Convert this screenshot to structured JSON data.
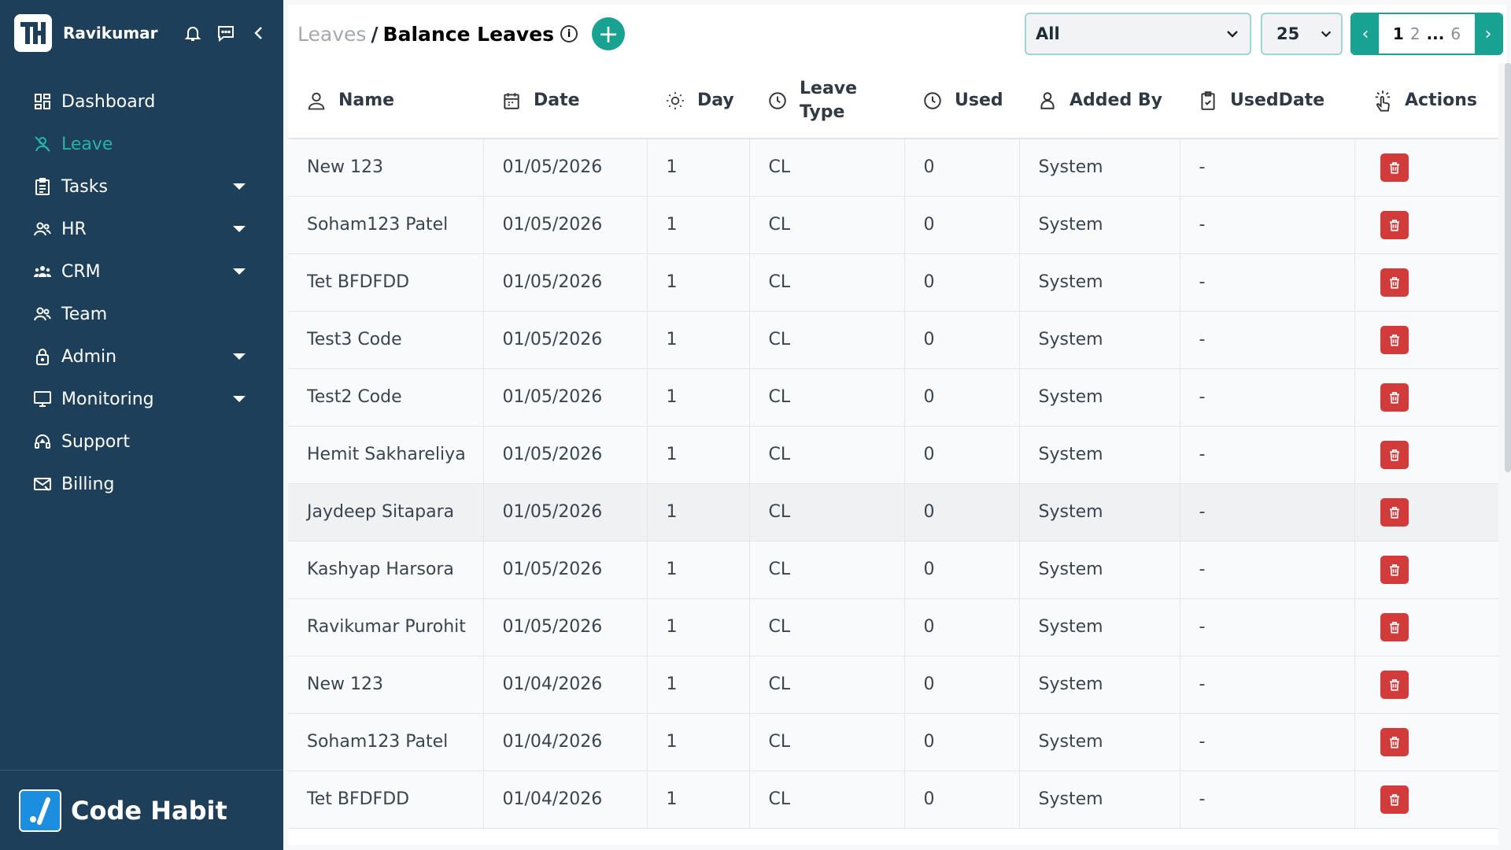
{
  "sidebar": {
    "user_name": "Ravikumar",
    "items": [
      {
        "label": "Dashboard",
        "icon": "dashboard-icon",
        "caret": false,
        "active": false
      },
      {
        "label": "Leave",
        "icon": "leave-icon",
        "caret": false,
        "active": true
      },
      {
        "label": "Tasks",
        "icon": "tasks-icon",
        "caret": true,
        "active": false
      },
      {
        "label": "HR",
        "icon": "hr-icon",
        "caret": true,
        "active": false
      },
      {
        "label": "CRM",
        "icon": "crm-icon",
        "caret": true,
        "active": false
      },
      {
        "label": "Team",
        "icon": "team-icon",
        "caret": false,
        "active": false
      },
      {
        "label": "Admin",
        "icon": "lock-icon",
        "caret": true,
        "active": false
      },
      {
        "label": "Monitoring",
        "icon": "monitor-icon",
        "caret": true,
        "active": false
      },
      {
        "label": "Support",
        "icon": "support-icon",
        "caret": false,
        "active": false
      },
      {
        "label": "Billing",
        "icon": "billing-icon",
        "caret": false,
        "active": false
      }
    ],
    "footer_brand": "Code Habit"
  },
  "header": {
    "crumb_parent": "Leaves",
    "crumb_sep": "/",
    "crumb_current": "Balance Leaves",
    "info_glyph": "i",
    "add_glyph": "+"
  },
  "filter": {
    "value": "All"
  },
  "page_size": {
    "value": "25"
  },
  "pagination": {
    "current": "1",
    "next": "2",
    "dots": "...",
    "last": "6",
    "prev_glyph": "‹",
    "next_glyph": "›"
  },
  "colors": {
    "sidebar_bg": "#1d3f59",
    "accent": "#17a291",
    "active_nav": "#26b3a6",
    "delete": "#d33a3a"
  },
  "table": {
    "columns": [
      {
        "label": "Name",
        "icon": "user-icon"
      },
      {
        "label": "Date",
        "icon": "calendar-icon"
      },
      {
        "label": "Day",
        "icon": "sun-icon"
      },
      {
        "label": "Leave Type",
        "icon": "clock-icon"
      },
      {
        "label": "Used",
        "icon": "clock-icon"
      },
      {
        "label": "Added By",
        "icon": "person-icon"
      },
      {
        "label": "UsedDate",
        "icon": "clipboard-icon"
      },
      {
        "label": "Actions",
        "icon": "pointer-icon"
      }
    ],
    "rows": [
      [
        "New 123",
        "01/05/2026",
        "1",
        "CL",
        "0",
        "System",
        "-"
      ],
      [
        "Soham123 Patel",
        "01/05/2026",
        "1",
        "CL",
        "0",
        "System",
        "-"
      ],
      [
        "Tet BFDFDD",
        "01/05/2026",
        "1",
        "CL",
        "0",
        "System",
        "-"
      ],
      [
        "Test3 Code",
        "01/05/2026",
        "1",
        "CL",
        "0",
        "System",
        "-"
      ],
      [
        "Test2 Code",
        "01/05/2026",
        "1",
        "CL",
        "0",
        "System",
        "-"
      ],
      [
        "Hemit Sakhareliya",
        "01/05/2026",
        "1",
        "CL",
        "0",
        "System",
        "-"
      ],
      [
        "Jaydeep Sitapara",
        "01/05/2026",
        "1",
        "CL",
        "0",
        "System",
        "-"
      ],
      [
        "Kashyap Harsora",
        "01/05/2026",
        "1",
        "CL",
        "0",
        "System",
        "-"
      ],
      [
        "Ravikumar Purohit",
        "01/05/2026",
        "1",
        "CL",
        "0",
        "System",
        "-"
      ],
      [
        "New 123",
        "01/04/2026",
        "1",
        "CL",
        "0",
        "System",
        "-"
      ],
      [
        "Soham123 Patel",
        "01/04/2026",
        "1",
        "CL",
        "0",
        "System",
        "-"
      ],
      [
        "Tet BFDFDD",
        "01/04/2026",
        "1",
        "CL",
        "0",
        "System",
        "-"
      ]
    ],
    "highlighted_row": 6
  }
}
